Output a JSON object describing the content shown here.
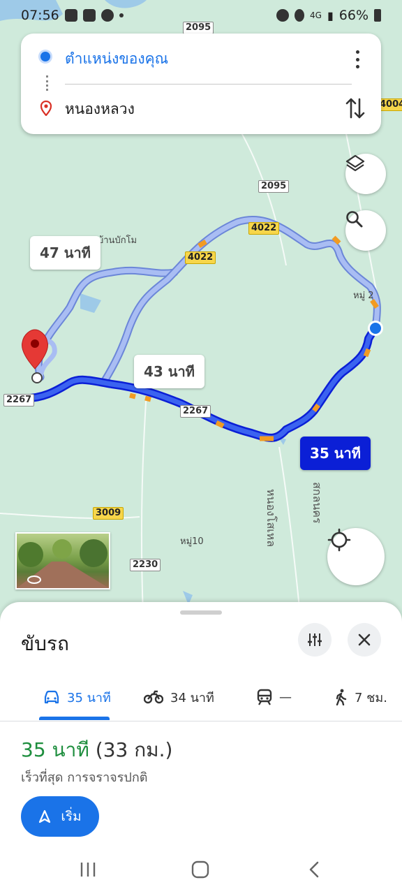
{
  "status_bar": {
    "time": "07:56",
    "network": "4G",
    "battery": "66%"
  },
  "directions": {
    "origin": "ตำแหน่งของคุณ",
    "destination": "หนองหลวง"
  },
  "map": {
    "route_labels": {
      "alt1": "47 นาที",
      "alt2": "43 นาที",
      "selected": "35 นาที"
    },
    "roads": [
      "2095",
      "2095",
      "4004",
      "4022",
      "4022",
      "2267",
      "2267",
      "3009",
      "2230",
      "2267"
    ],
    "places": [
      "บ้านบักโม",
      "หมู่ 2",
      "หมู่10",
      "หนองโสเหล",
      "สกลนคร"
    ]
  },
  "sheet": {
    "mode_title": "ขับรถ",
    "tabs": [
      {
        "icon": "car-icon",
        "label": "35 นาที"
      },
      {
        "icon": "motorcycle-icon",
        "label": "34 นาที"
      },
      {
        "icon": "transit-icon",
        "label": "—"
      },
      {
        "icon": "walk-icon",
        "label": "7 ชม."
      }
    ],
    "summary_time": "35 นาที",
    "summary_distance": "(33 กม.)",
    "summary_desc": "เร็วที่สุด การจราจรปกติ",
    "start_label": "เริ่ม"
  },
  "colors": {
    "accent": "#1a73e8",
    "route_selected": "#0b1fd6",
    "route_alt": "#8aa4f0",
    "traffic_slow": "#f29b22",
    "eta_green": "#1e8e3e"
  }
}
